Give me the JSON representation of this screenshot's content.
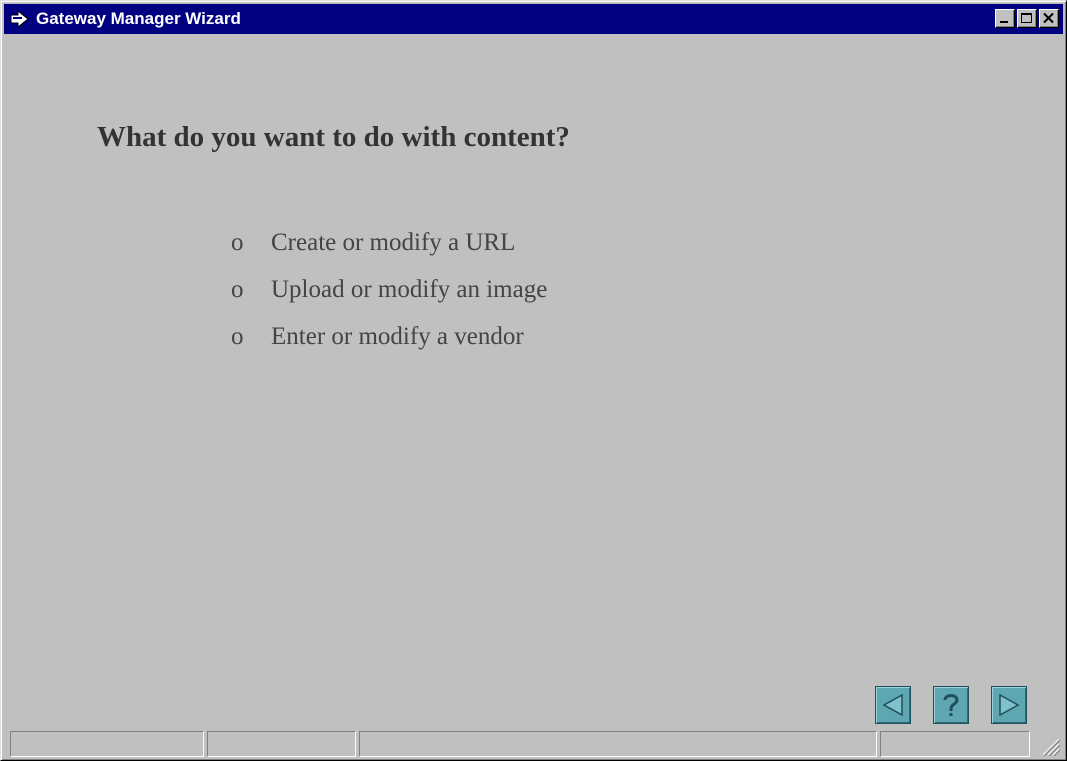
{
  "window": {
    "title": "Gateway Manager Wizard",
    "icon": "wizard-arrow-icon",
    "caption_buttons": [
      "minimize-icon",
      "maximize-icon",
      "close-icon"
    ]
  },
  "main": {
    "question": "What do you want to do with content?",
    "bullet_char": "o",
    "options": [
      {
        "label": "Create or modify a URL"
      },
      {
        "label": "Upload or modify an image"
      },
      {
        "label": "Enter or modify a vendor"
      }
    ]
  },
  "nav": {
    "back_icon": "back-arrow-icon",
    "help_icon": "help-question-icon",
    "next_icon": "next-arrow-icon",
    "button_color": "#5fa6b3"
  },
  "status": {
    "panes": [
      "",
      "",
      "",
      ""
    ]
  },
  "colors": {
    "titlebar": "#000080",
    "face": "#c0c0c0"
  }
}
